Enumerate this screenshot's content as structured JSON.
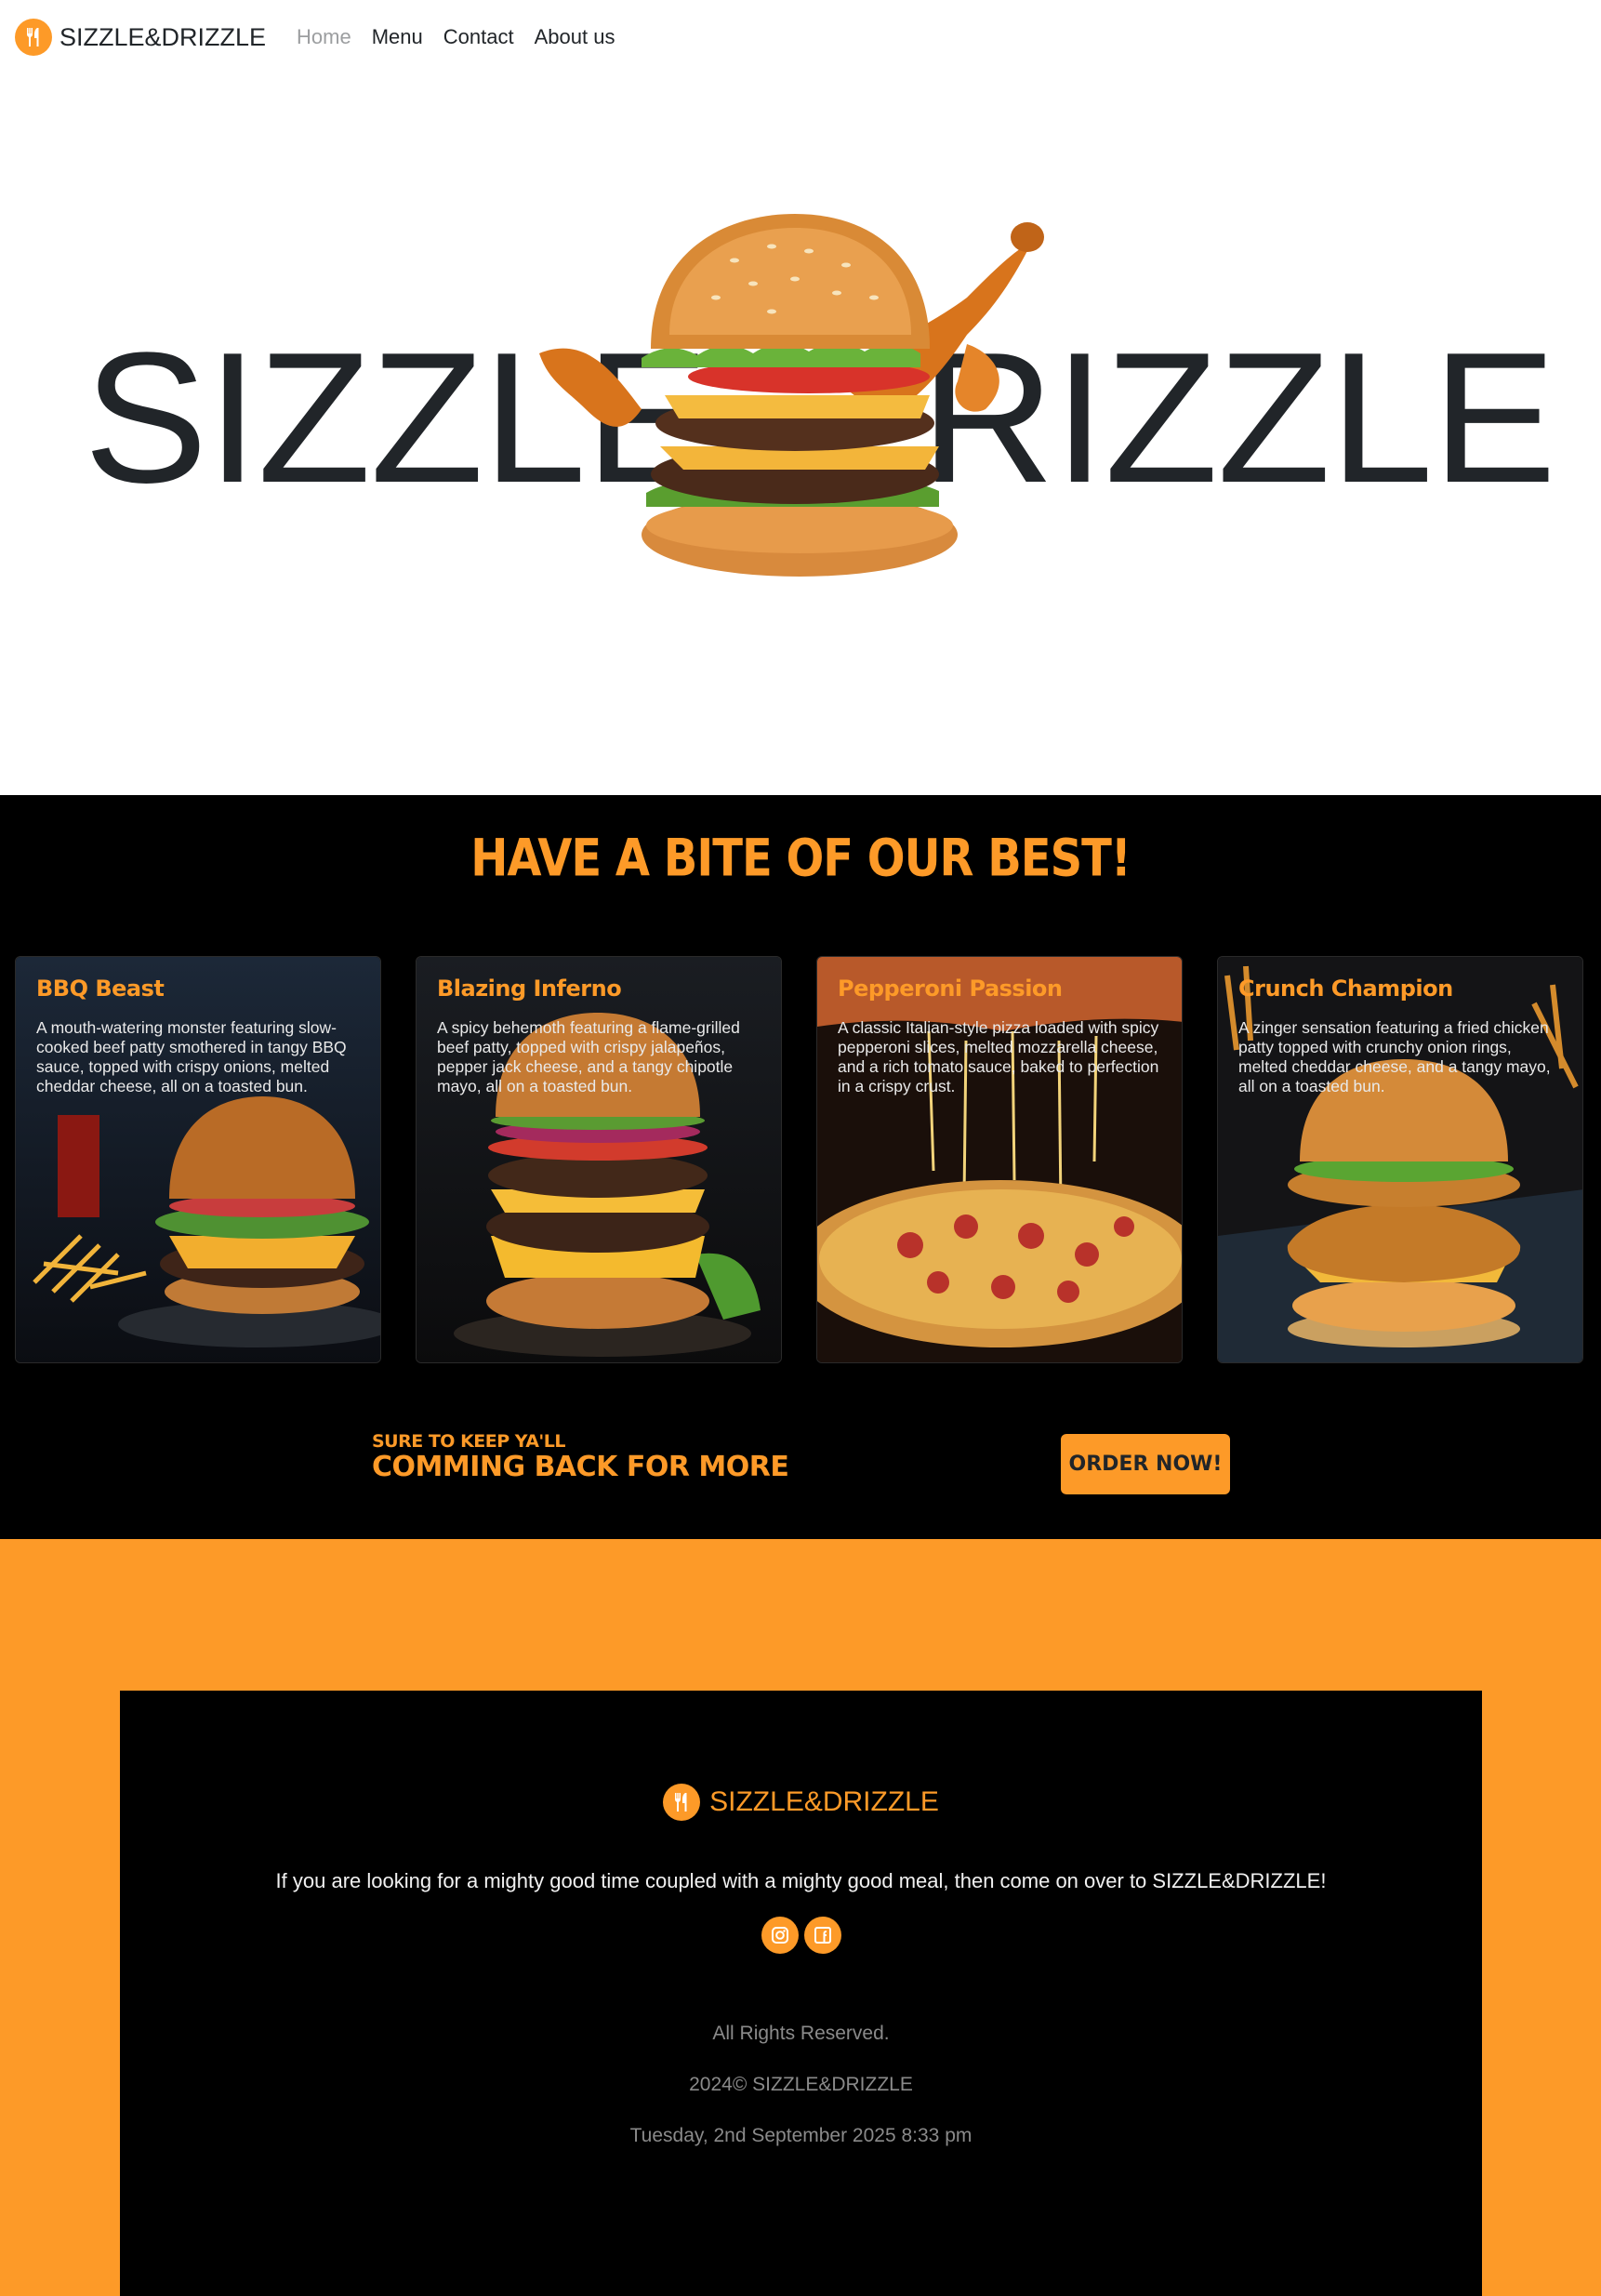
{
  "nav": {
    "brand": "SIZZLE&DRIZZLE",
    "links": [
      "Home",
      "Menu",
      "Contact",
      "About us"
    ]
  },
  "hero": {
    "left_word": "SIZZLE",
    "right_word": "RIZZLE"
  },
  "featured": {
    "heading": "HAVE A BITE OF OUR BEST!",
    "cards": [
      {
        "title": "BBQ Beast",
        "description": "A mouth-watering monster featuring slow-cooked beef patty smothered in tangy BBQ sauce, topped with crispy onions, melted cheddar cheese, all on a toasted bun."
      },
      {
        "title": "Blazing Inferno",
        "description": "A spicy behemoth featuring a flame-grilled beef patty, topped with crispy jalapeños, pepper jack cheese, and a tangy chipotle mayo, all on a toasted bun."
      },
      {
        "title": "Pepperoni Passion",
        "description": "A classic Italian-style pizza loaded with spicy pepperoni slices, melted mozzarella cheese, and a rich tomato sauce, baked to perfection in a crispy crust."
      },
      {
        "title": "Crunch Champion",
        "description": "A zinger sensation featuring a fried chicken patty topped with crunchy onion rings, melted cheddar cheese, and a tangy mayo, all on a toasted bun."
      }
    ],
    "promo_small": "SURE TO KEEP YA'LL",
    "promo_big": "COMMING BACK FOR MORE",
    "order_button": "ORDER NOW!"
  },
  "footer": {
    "brand": "SIZZLE&DRIZZLE",
    "tagline": "If you are looking for a mighty good time coupled with a mighty good meal, then come on over to SIZZLE&DRIZZLE!",
    "socials": [
      "instagram-icon",
      "facebook-icon"
    ],
    "rights": "All Rights Reserved.",
    "copyright": "2024© SIZZLE&DRIZZLE",
    "datetime": "Tuesday, 2nd September 2025 8:33 pm"
  },
  "colors": {
    "accent": "#fd9a28",
    "dark": "#000000",
    "text": "#212529"
  }
}
